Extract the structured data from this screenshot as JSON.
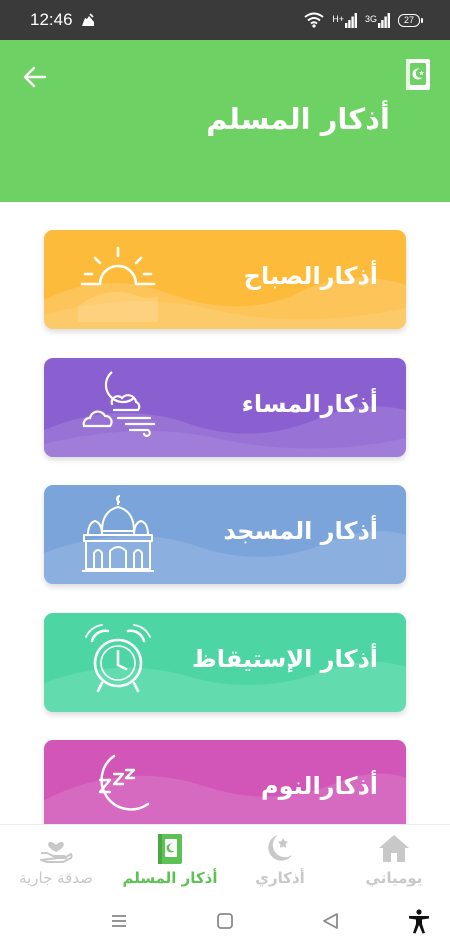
{
  "status_bar": {
    "time": "12:46",
    "network_label": "H+",
    "network_label_2": "3G",
    "battery": "27"
  },
  "header": {
    "title": "أذكار المسلم"
  },
  "colors": {
    "header": "#6ed163",
    "accent_active": "#5cc253",
    "inactive": "#c8c8c8"
  },
  "cards": [
    {
      "label": "أذكارالصباح",
      "icon": "sunrise-icon",
      "color": "#fdbb3c"
    },
    {
      "label": "أذكارالمساء",
      "icon": "moon-cloud-icon",
      "color": "#8a5fd0"
    },
    {
      "label": "أذكار المسجد",
      "icon": "mosque-icon",
      "color": "#7ba4db"
    },
    {
      "label": "أذكار الإستيقاظ",
      "icon": "alarm-clock-icon",
      "color": "#4dd6a4"
    },
    {
      "label": "أذكارالنوم",
      "icon": "sleep-moon-icon",
      "color": "#d156b8"
    }
  ],
  "bottom_nav": {
    "items": [
      {
        "label": "يومياتي",
        "icon": "home-icon",
        "active": false
      },
      {
        "label": "أذكاري",
        "icon": "star-crescent-icon",
        "active": false
      },
      {
        "label": "أذكار المسلم",
        "icon": "book-icon",
        "active": true
      },
      {
        "label": "صدقة جارية",
        "icon": "charity-hand-icon",
        "active": false
      }
    ]
  }
}
